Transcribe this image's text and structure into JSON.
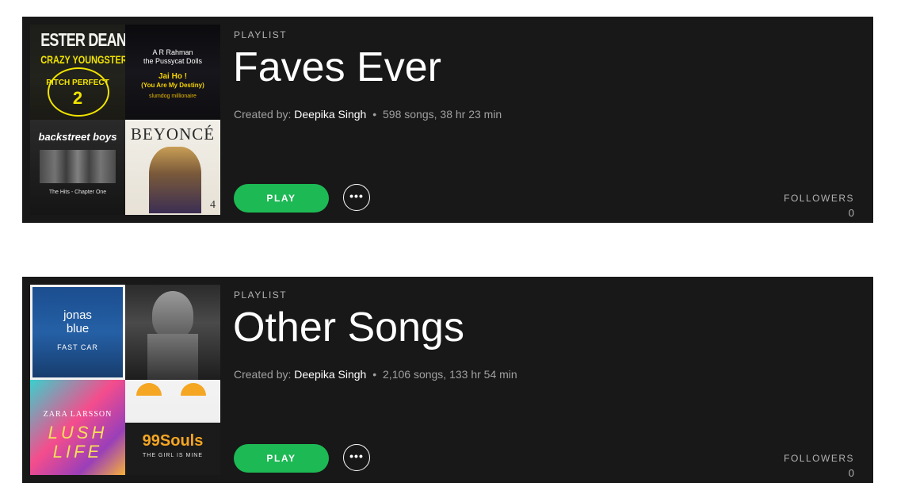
{
  "playlists": [
    {
      "type_label": "PLAYLIST",
      "title": "Faves Ever",
      "created_by_label": "Created by:",
      "owner": "Deepika Singh",
      "separator": "•",
      "stats": "598 songs, 38 hr 23 min",
      "play_label": "PLAY",
      "more_label": "•••",
      "followers_label": "FOLLOWERS",
      "followers_count": "0",
      "covers": [
        {
          "lines": [
            "ESTER DEAN",
            "CRAZY YOUNGSTERS",
            "PITCH PERFECT",
            "2"
          ]
        },
        {
          "lines": [
            "A R Rahman",
            "the Pussycat Dolls",
            "Jai Ho !",
            "(You Are My Destiny)",
            "slumdog millionaire"
          ]
        },
        {
          "lines": [
            "backstreet boys",
            "The Hits - Chapter One"
          ]
        },
        {
          "lines": [
            "BEYONCÉ",
            "4"
          ]
        }
      ]
    },
    {
      "type_label": "PLAYLIST",
      "title": "Other Songs",
      "created_by_label": "Created by:",
      "owner": "Deepika Singh",
      "separator": "•",
      "stats": "2,106 songs, 133 hr 54 min",
      "play_label": "PLAY",
      "more_label": "•••",
      "followers_label": "FOLLOWERS",
      "followers_count": "0",
      "covers": [
        {
          "lines": [
            "jonas",
            "blue",
            "FAST CAR"
          ]
        },
        {
          "lines": []
        },
        {
          "lines": [
            "ZARA LARSSON",
            "LUSH",
            "LIFE"
          ]
        },
        {
          "lines": [
            "99Souls",
            "THE GIRL IS MINE"
          ]
        }
      ]
    }
  ]
}
